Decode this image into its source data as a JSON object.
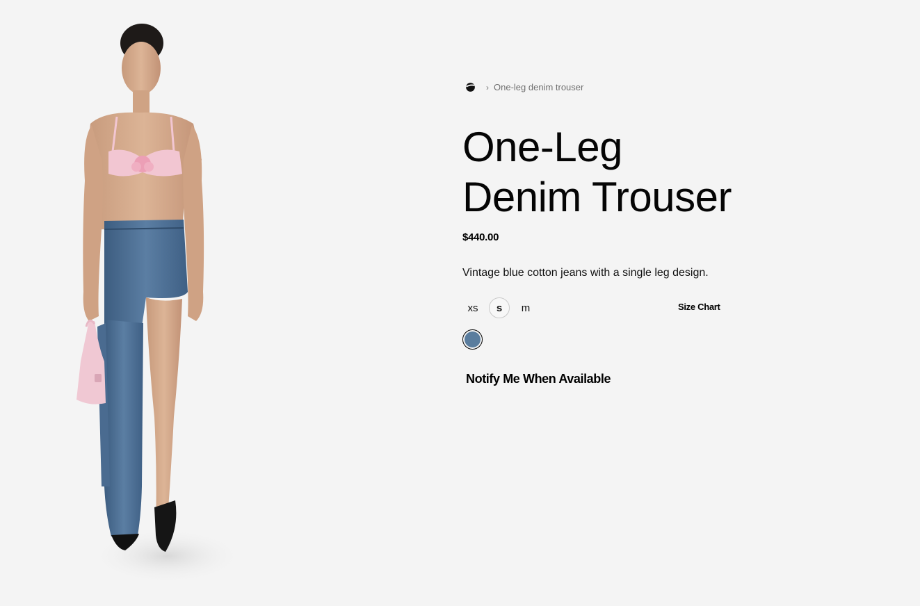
{
  "breadcrumb": {
    "home_icon": "brand-logo-icon",
    "current": "One-leg denim trouser"
  },
  "product": {
    "title_line1": "One-Leg",
    "title_line2": "Denim Trouser",
    "price": "$440.00",
    "description": "Vintage blue cotton jeans with a single leg design.",
    "sizes": [
      {
        "label": "xs",
        "selected": false
      },
      {
        "label": "s",
        "selected": true
      },
      {
        "label": "m",
        "selected": false
      }
    ],
    "size_chart_label": "Size Chart",
    "colors": [
      {
        "hex": "#5a7d9e",
        "selected": true
      }
    ],
    "notify_label": "Notify Me When Available"
  },
  "image": {
    "subject": "model-wearing-one-leg-denim-trouser"
  }
}
